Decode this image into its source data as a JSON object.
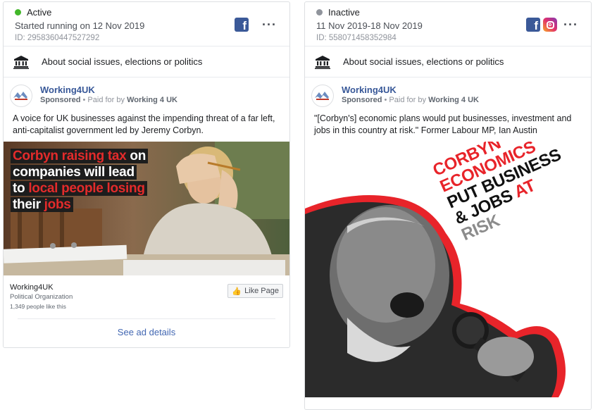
{
  "cards": [
    {
      "status": "Active",
      "status_color": "#42b72a",
      "run_info": "Started running on 12 Nov 2019",
      "id": "ID: 2958360447527292",
      "platform_icons": [
        "facebook-icon"
      ],
      "category": "About social issues, elections or politics",
      "advertiser": "Working4UK",
      "sponsored_prefix": "Sponsored",
      "paid_for_label": "Paid for by",
      "paid_for_name": "Working 4 UK",
      "ad_text": "A voice for UK businesses against the impending threat of a far left, anti-capitalist government led by Jeremy Corbyn.",
      "image_caption": {
        "line1_red": "Corbyn raising tax",
        "line1_white": " on",
        "line2": "companies will lead",
        "line3_white": "to ",
        "line3_red": "local people losing",
        "line4_white": "their ",
        "line4_red": "jobs"
      },
      "page_name": "Working4UK",
      "page_type": "Political Organization",
      "page_likes": "1,349 people like this",
      "like_button": "Like Page",
      "see_details": "See ad details"
    },
    {
      "status": "Inactive",
      "status_color": "#90949c",
      "run_info": "11 Nov 2019-18 Nov 2019",
      "id": "ID: 558071458352984",
      "platform_icons": [
        "facebook-icon",
        "instagram-icon"
      ],
      "category": "About social issues, elections or politics",
      "advertiser": "Working4UK",
      "sponsored_prefix": "Sponsored",
      "paid_for_label": "Paid for by",
      "paid_for_name": "Working 4 UK",
      "ad_text": "\"[Corbyn's] economic plans would put businesses, investment and jobs in this country at risk.\" Former Labour MP, Ian Austin",
      "poster": {
        "line1": "CORBYN",
        "line2": "ECONOMICS",
        "line3": "PUT BUSINESS",
        "line4a": "& JOBS ",
        "line4b": "AT",
        "line5": "RISK"
      }
    }
  ],
  "colors": {
    "link_blue": "#4267b2",
    "advertiser_blue": "#385898",
    "poster_red": "#e8242a"
  }
}
